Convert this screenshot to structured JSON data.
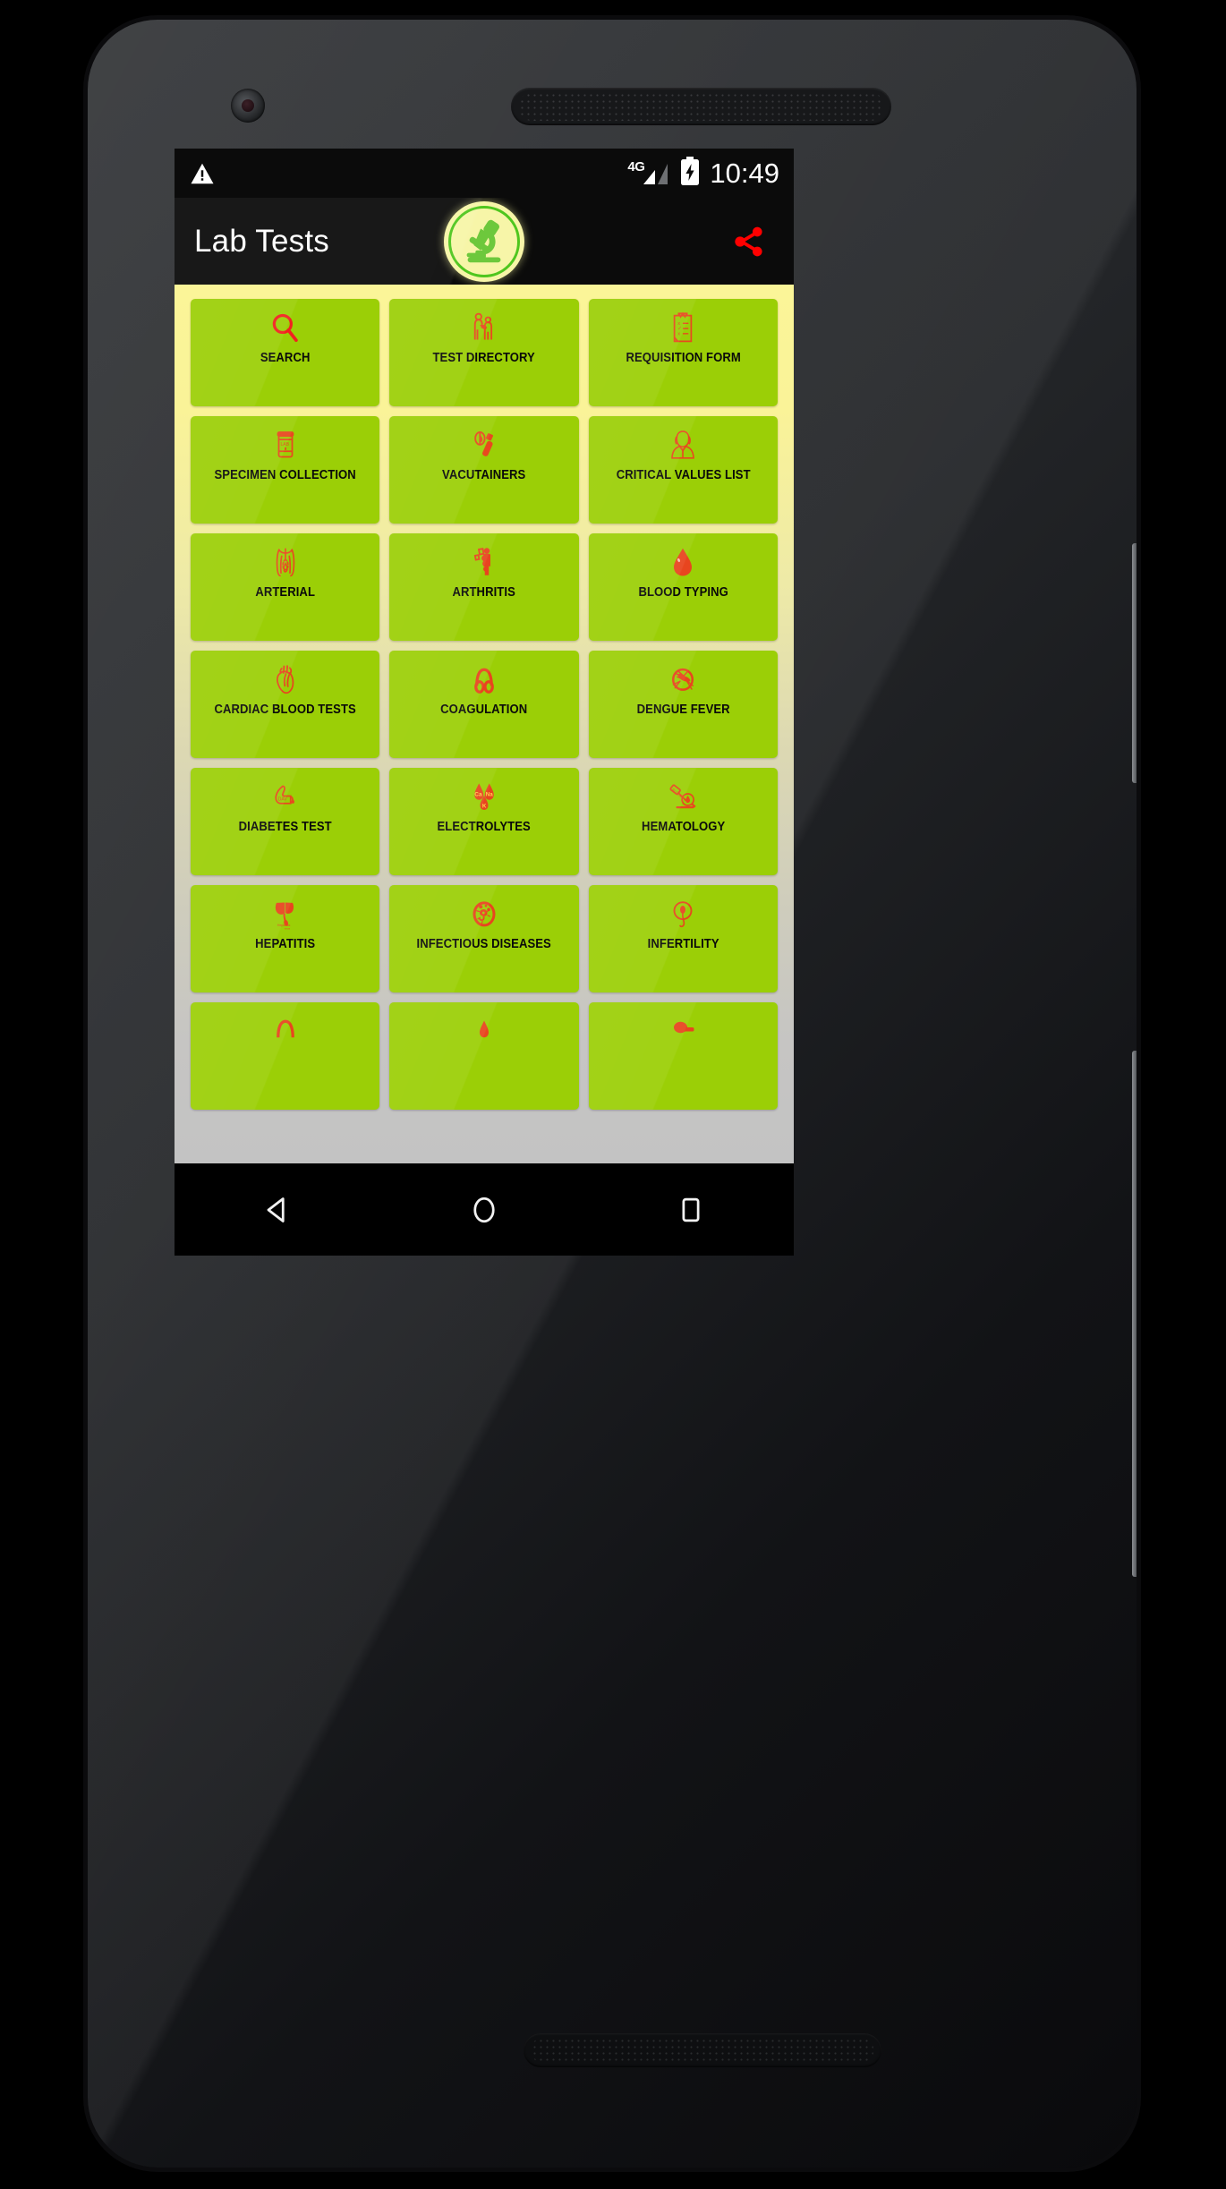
{
  "device": {
    "frame": "android-phone-mockup",
    "camera": "front-camera",
    "earpiece": "earpiece-speaker",
    "bottom_speaker": "bottom-speaker",
    "power_button": "power-button",
    "volume_button": "volume-rocker"
  },
  "statusbar": {
    "warning_icon": "warning-triangle-icon",
    "network_label": "4G",
    "signal_icon": "signal-bars-icon",
    "battery_icon": "battery-charging-icon",
    "time": "10:49"
  },
  "appbar": {
    "title": "Lab Tests",
    "logo_icon": "microscope-logo-icon",
    "share_icon": "share-icon",
    "title_color": "#ffffff",
    "background_color": "#0b0b0b",
    "share_color": "#ff0000",
    "logo_bg_color": "#f7f5a8",
    "logo_fg_color": "#6dc83c"
  },
  "theme": {
    "tile_color": "#9bcf06",
    "tile_label_color": "#0a0a0a",
    "tile_icon_color": "#e8451f",
    "page_bg_top": "#fbf598",
    "page_bg_bottom": "#c3c3c3"
  },
  "grid": {
    "columns": 3,
    "tiles": [
      {
        "label": "SEARCH",
        "icon": "magnifier-icon"
      },
      {
        "label": "TEST DIRECTORY",
        "icon": "two-people-icon"
      },
      {
        "label": "REQUISITION FORM",
        "icon": "clipboard-checklist-icon"
      },
      {
        "label": "SPECIMEN COLLECTION",
        "icon": "specimen-cup-icon"
      },
      {
        "label": "VACUTAINERS",
        "icon": "vacutainer-tube-icon"
      },
      {
        "label": "CRITICAL VALUES LIST",
        "icon": "nurse-icon"
      },
      {
        "label": "ARTERIAL",
        "icon": "lungs-arterial-icon"
      },
      {
        "label": "ARTHRITIS",
        "icon": "arthritis-person-icon"
      },
      {
        "label": "BLOOD TYPING",
        "icon": "blood-drop-icon"
      },
      {
        "label": "CARDIAC BLOOD TESTS",
        "icon": "heart-anatomy-icon"
      },
      {
        "label": "COAGULATION",
        "icon": "coagulation-icon"
      },
      {
        "label": "DENGUE FEVER",
        "icon": "mosquito-icon"
      },
      {
        "label": "DIABETES TEST",
        "icon": "finger-prick-icon"
      },
      {
        "label": "ELECTROLYTES",
        "icon": "electrolyte-drops-icon"
      },
      {
        "label": "HEMATOLOGY",
        "icon": "microscope-slide-icon"
      },
      {
        "label": "HEPATITIS",
        "icon": "liver-icon"
      },
      {
        "label": "INFECTIOUS DISEASES",
        "icon": "germ-circle-icon"
      },
      {
        "label": "INFERTILITY",
        "icon": "sperm-egg-icon"
      },
      {
        "label": "",
        "icon": "partial-row-icon-1"
      },
      {
        "label": "",
        "icon": "partial-row-icon-2"
      },
      {
        "label": "",
        "icon": "partial-row-icon-3"
      }
    ]
  },
  "navbar": {
    "back": "back-triangle-icon",
    "home": "home-circle-icon",
    "recents": "recents-square-icon"
  }
}
